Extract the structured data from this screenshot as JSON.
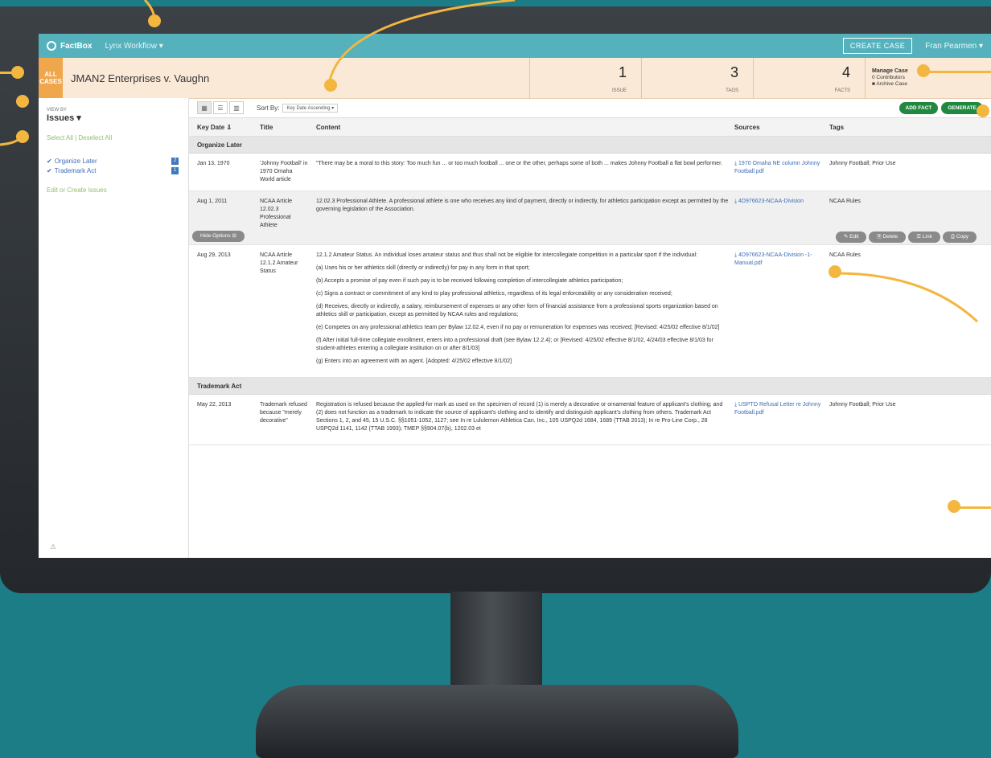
{
  "app": {
    "brand": "FactBox",
    "workflow": "Lynx Workflow ▾",
    "create_case": "CREATE CASE",
    "user_menu": "Fran Pearmen ▾"
  },
  "case": {
    "all_cases_label": "ALL CASES",
    "title": "JMAN2 Enterprises v. Vaughn",
    "stats": [
      {
        "value": "1",
        "label": "ISSUE"
      },
      {
        "value": "3",
        "label": "TAGS"
      },
      {
        "value": "4",
        "label": "FACTS"
      }
    ],
    "manage": {
      "title": "Manage Case",
      "contributors": "0 Contributors",
      "archive": "Archive Case"
    }
  },
  "sidebar": {
    "view_by_label": "VIEW BY",
    "view_by_value": "Issues ▾",
    "select_all": "Select All",
    "deselect_all": "Deselect All",
    "issues": [
      {
        "label": "Organize Later",
        "count": "2"
      },
      {
        "label": "Trademark Act",
        "count": "1"
      }
    ],
    "edit_issues": "Edit or Create Issues",
    "warning_glyph": "⚠"
  },
  "toolbar": {
    "sort_by_label": "Sort By:",
    "sort_value": "Key Date Ascending ▾",
    "add_fact": "ADD FACT",
    "generate": "GENERATE"
  },
  "columns": {
    "key_date": "Key Date ⇩",
    "title": "Title",
    "content": "Content",
    "sources": "Sources",
    "tags": "Tags"
  },
  "groups": [
    {
      "name": "Organize Later",
      "rows": [
        {
          "date": "Jan 13, 1970",
          "title": "'Johnny Football' in 1970 Omaha World article",
          "content": [
            "\"There may be a moral to this story: Too much fun ... or too much football ... one or the other, perhaps some of both ... makes Johnny Football a flat bowl performer."
          ],
          "source": "⤓ 1970 Omaha NE column Johnny Football.pdf",
          "tags": "Johnny Football; Prior Use"
        },
        {
          "date": "Aug 1, 2011",
          "title": "NCAA Article 12.02.3 Professional Athlete",
          "content": [
            "12.02.3 Professional Athlete. A professional athlete is one who receives any kind of payment, directly or indirectly, for athletics participation except as permitted by the governing legislation of the Association."
          ],
          "source": "⤓ 4D976623-NCAA-Division",
          "tags": "NCAA Rules"
        },
        {
          "date": "Aug 29, 2013",
          "title": "NCAA Article 12.1.2 Amateur Status",
          "content": [
            "12.1.2 Amateur Status. An individual loses amateur status and thus shall not be eligible for intercollegiate competition in a particular sport if the individual:",
            "(a) Uses his or her athletics skill (directly or indirectly) for pay in any form in that sport;",
            "(b) Accepts a promise of pay even if such pay is to be received following completion of intercollegiate athletics participation;",
            "(c) Signs a contract or commitment of any kind to play professional athletics, regardless of its legal enforceability or any consideration received;",
            "(d) Receives, directly or indirectly, a salary, reimbursement of expenses or any other form of financial assistance from a professional sports organization based on athletics skill or participation, except as permitted by NCAA rules and regulations;",
            "(e) Competes on any professional athletics team per Bylaw 12.02.4, even if no pay or remuneration for expenses was received; [Revised: 4/25/02 effective 8/1/02]",
            "(f) After initial full-time collegiate enrollment, enters into a professional draft (see Bylaw 12.2.4); or [Revised: 4/25/02 effective 8/1/02, 4/24/03 effective 8/1/03 for student-athletes entering a collegiate institution on or after 8/1/03]",
            "(g) Enters into an agreement with an agent. [Adopted: 4/25/02 effective 8/1/02]"
          ],
          "source": "⤓ 4D976623-NCAA-Division -1-Manual.pdf",
          "tags": "NCAA Rules"
        }
      ]
    },
    {
      "name": "Trademark Act",
      "rows": [
        {
          "date": "May 22, 2013",
          "title": "Trademark refused because \"merely decorative\"",
          "content": [
            "Registration is refused because the applied-for mark as used on the specimen of record (1) is merely a decorative or ornamental feature of applicant's clothing; and (2) does not function as a trademark to indicate the source of applicant's clothing and to identify and distinguish applicant's clothing from others. Trademark Act Sections 1, 2, and 45, 15 U.S.C. §§1051-1052, 1127; see In re Lululemon Athletica Can. Inc., 105 USPQ2d 1684, 1689 (TTAB 2013); In re Pro-Line Corp., 28 USPQ2d 1141, 1142 (TTAB 1993); TMEP §§904.07(b), 1202.03 et"
          ],
          "source": "⤓ USPTO Refusal Letter re Johnny Football.pdf",
          "tags": "Johnny Football; Prior Use"
        }
      ]
    }
  ],
  "row_options": {
    "hide_options": "Hide Options ⊟",
    "actions": [
      "✎ Edit",
      "⎘ Delete",
      "☰ Link",
      "⎙ Copy"
    ]
  }
}
